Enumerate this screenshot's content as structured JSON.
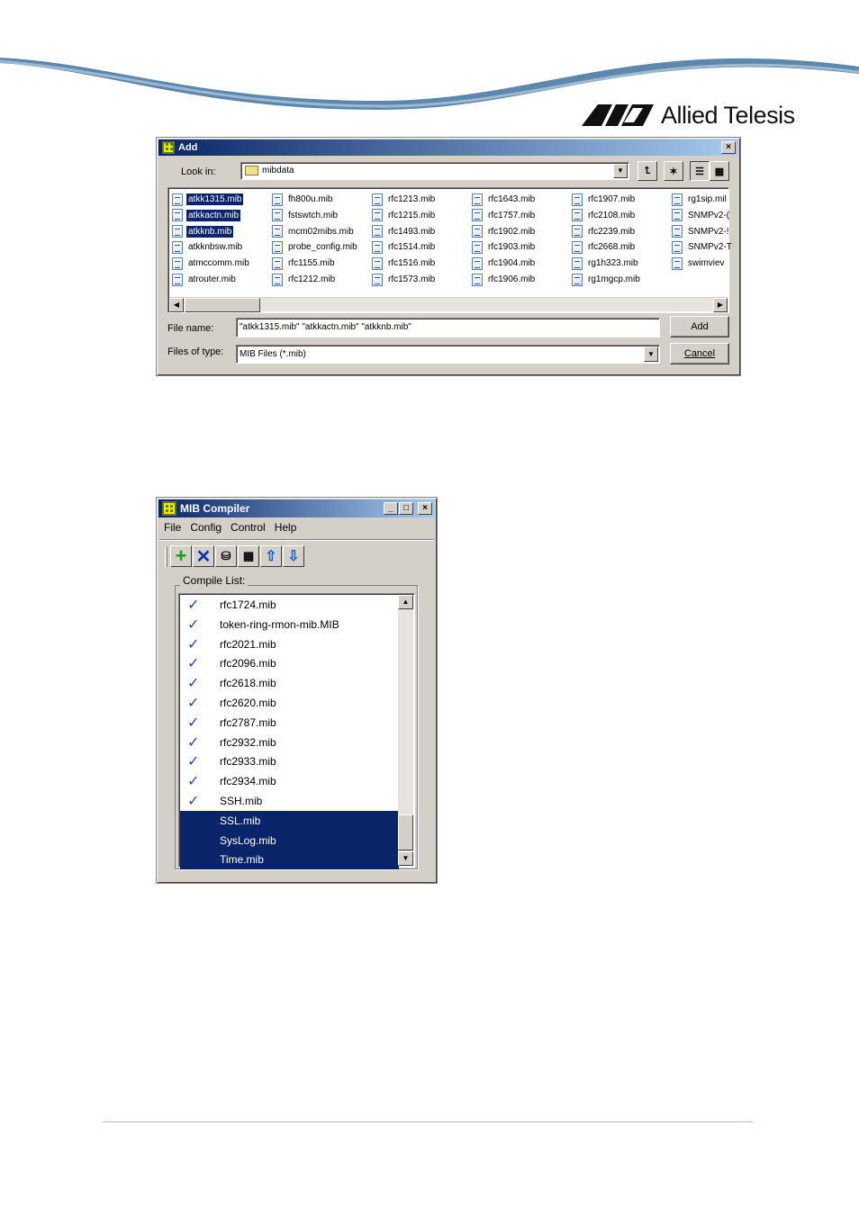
{
  "brand": {
    "name": "Allied Telesis"
  },
  "add_dialog": {
    "title": "Add",
    "close_label": "×",
    "look_in_label": "Look in:",
    "look_in_value": "mibdata",
    "files": [
      [
        {
          "name": "atkk1315.mib",
          "selected": true
        },
        {
          "name": "atkkactn.mib",
          "selected": true
        },
        {
          "name": "atkknb.mib",
          "selected": true
        },
        {
          "name": "atkknbsw.mib"
        },
        {
          "name": "atmccomm.mib"
        },
        {
          "name": "atrouter.mib"
        }
      ],
      [
        {
          "name": "fh800u.mib"
        },
        {
          "name": "fstswtch.mib"
        },
        {
          "name": "mcm02mibs.mib"
        },
        {
          "name": "probe_config.mib"
        },
        {
          "name": "rfc1155.mib"
        },
        {
          "name": "rfc1212.mib"
        }
      ],
      [
        {
          "name": "rfc1213.mib"
        },
        {
          "name": "rfc1215.mib"
        },
        {
          "name": "rfc1493.mib"
        },
        {
          "name": "rfc1514.mib"
        },
        {
          "name": "rfc1516.mib"
        },
        {
          "name": "rfc1573.mib"
        }
      ],
      [
        {
          "name": "rfc1643.mib"
        },
        {
          "name": "rfc1757.mib"
        },
        {
          "name": "rfc1902.mib"
        },
        {
          "name": "rfc1903.mib"
        },
        {
          "name": "rfc1904.mib"
        },
        {
          "name": "rfc1906.mib"
        }
      ],
      [
        {
          "name": "rfc1907.mib"
        },
        {
          "name": "rfc2108.mib"
        },
        {
          "name": "rfc2239.mib"
        },
        {
          "name": "rfc2668.mib"
        },
        {
          "name": "rg1h323.mib"
        },
        {
          "name": "rg1mgcp.mib"
        }
      ],
      [
        {
          "name": "rg1sip.mil"
        },
        {
          "name": "SNMPv2-("
        },
        {
          "name": "SNMPv2-!"
        },
        {
          "name": "SNMPv2-T"
        },
        {
          "name": "swimviev"
        }
      ]
    ],
    "file_name_label": "File name:",
    "file_name_value": "\"atkk1315.mib\" \"atkkactn.mib\" \"atkknb.mib\"",
    "files_of_type_label": "Files of type:",
    "files_of_type_value": "MIB Files (*.mib)",
    "add_button": "Add",
    "cancel_button": "Cancel"
  },
  "mib_compiler": {
    "title": "MIB Compiler",
    "menu": [
      "File",
      "Config",
      "Control",
      "Help"
    ],
    "compile_list_label": "Compile List:",
    "items": [
      {
        "name": "rfc1724.mib",
        "checked": true
      },
      {
        "name": "token-ring-rmon-mib.MIB",
        "checked": true
      },
      {
        "name": "rfc2021.mib",
        "checked": true
      },
      {
        "name": "rfc2096.mib",
        "checked": true
      },
      {
        "name": "rfc2618.mib",
        "checked": true
      },
      {
        "name": "rfc2620.mib",
        "checked": true
      },
      {
        "name": "rfc2787.mib",
        "checked": true
      },
      {
        "name": "rfc2932.mib",
        "checked": true
      },
      {
        "name": "rfc2933.mib",
        "checked": true
      },
      {
        "name": "rfc2934.mib",
        "checked": true
      },
      {
        "name": "SSH.mib",
        "checked": true
      },
      {
        "name": "SSL.mib",
        "checked": false,
        "selected": true
      },
      {
        "name": "SysLog.mib",
        "checked": false,
        "selected": true
      },
      {
        "name": "Time.mib",
        "checked": false,
        "selected": true
      }
    ]
  },
  "colors": {
    "selection": "#0a246a",
    "window": "#d4d0c8",
    "check": "#2040d0"
  }
}
